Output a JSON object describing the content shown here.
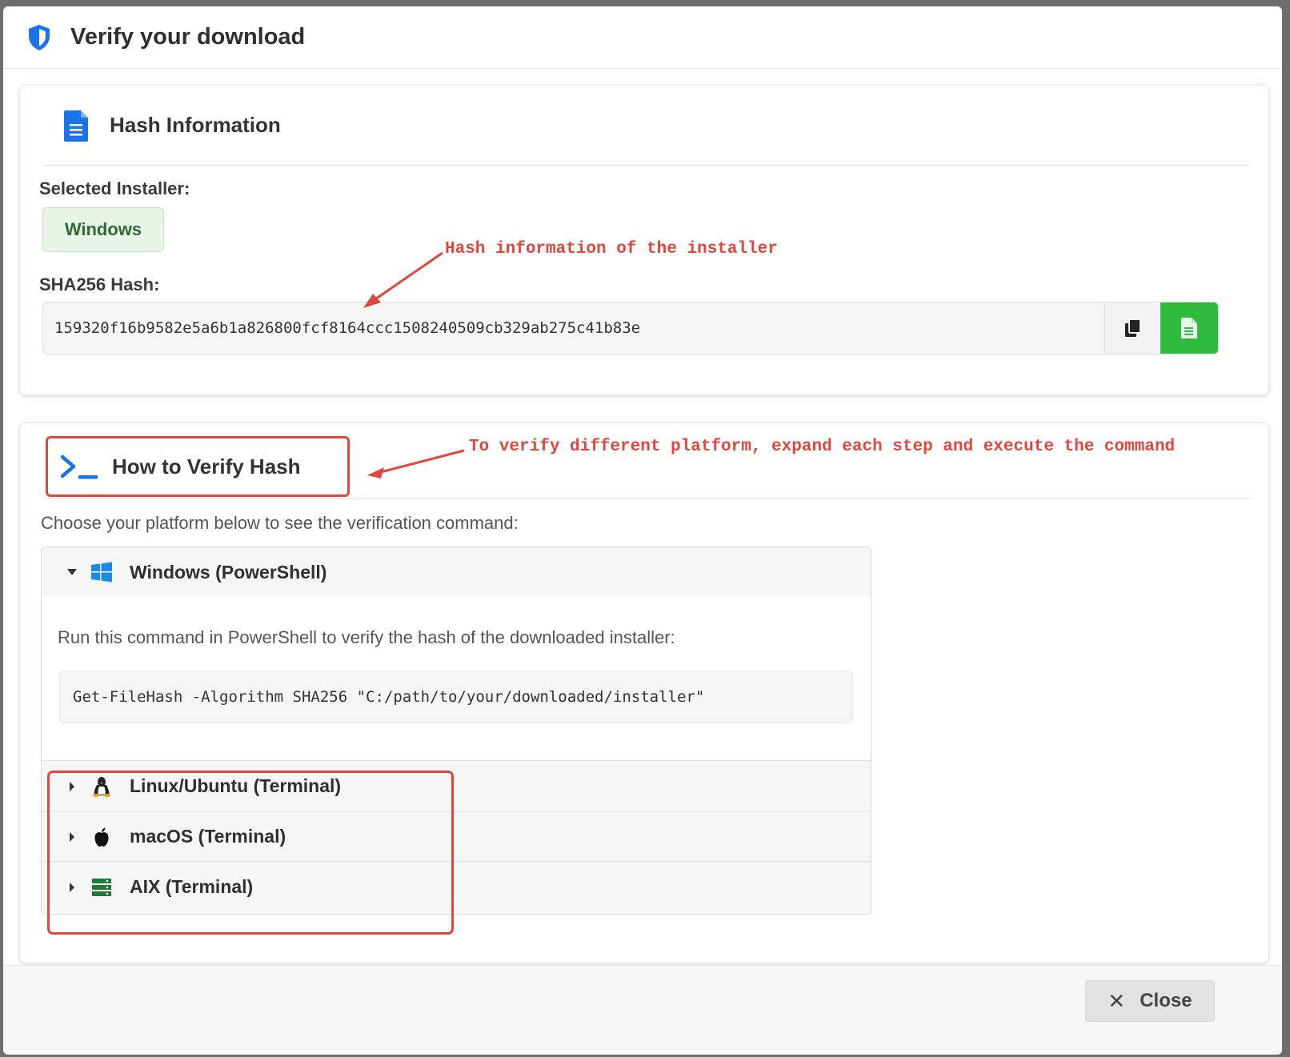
{
  "modal": {
    "title": "Verify your download",
    "icon": "shield-icon",
    "accent": "#1a73e8"
  },
  "hash_info": {
    "title": "Hash Information",
    "icon": "document-icon",
    "selected_installer_label": "Selected Installer:",
    "selected_installer_value": "Windows",
    "sha_label": "SHA256 Hash:",
    "sha_value": "159320f16b9582e5a6b1a826800fcf8164ccc1508240509cb329ab275c41b83e",
    "copy_icon": "copy-icon",
    "save_icon": "file-icon",
    "save_color": "#2fbc3e"
  },
  "verify": {
    "title": "How to Verify Hash",
    "icon": "terminal-icon",
    "instructions": "Choose your platform below to see the verification command:",
    "platforms": [
      {
        "label": "Windows (PowerShell)",
        "icon": "windows-icon",
        "expanded": true,
        "description": "Run this command in PowerShell to verify the hash of the downloaded installer:",
        "command": "Get-FileHash -Algorithm SHA256 \"C:/path/to/your/downloaded/installer\""
      },
      {
        "label": "Linux/Ubuntu (Terminal)",
        "icon": "linux-icon",
        "expanded": false
      },
      {
        "label": "macOS (Terminal)",
        "icon": "apple-icon",
        "expanded": false
      },
      {
        "label": "AIX (Terminal)",
        "icon": "server-icon",
        "expanded": false
      }
    ]
  },
  "annotations": {
    "hash": "Hash information of the installer",
    "verify": "To verify different platform, expand each step and execute the command",
    "color": "#e0463c"
  },
  "footer": {
    "close_label": "Close",
    "close_icon": "close-icon"
  }
}
